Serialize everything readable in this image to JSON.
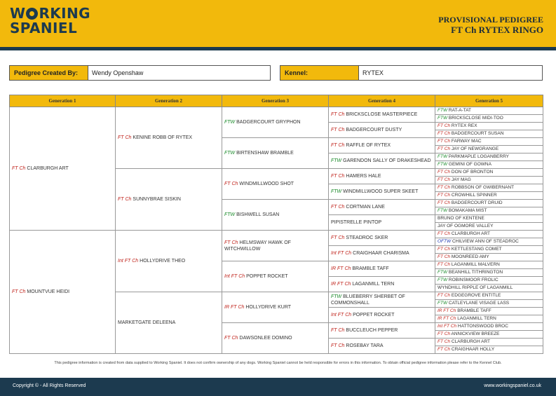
{
  "header": {
    "logo_line1_a": "W",
    "logo_line1_b": "RKING",
    "logo_line2": "SPANIEL",
    "doc_type": "PROVISIONAL PEDIGREE",
    "dog_name": "FT Ch RYTEX RINGO",
    "accent_color": "#f2b90c",
    "brand_color": "#1c3a4f"
  },
  "meta": {
    "created_by_label": "Pedigree Created By:",
    "created_by_value": "Wendy Openshaw",
    "kennel_label": "Kennel:",
    "kennel_value": "RYTEX"
  },
  "columns": [
    "Generation 1",
    "Generation 2",
    "Generation 3",
    "Generation 4",
    "Generation 5"
  ],
  "gen1": [
    {
      "title": "FT Ch",
      "name": "CLARBURGH ART"
    },
    {
      "title": "FT Ch",
      "name": "MOUNTVUE HEIDI"
    }
  ],
  "gen2": [
    {
      "title": "FT Ch",
      "name": "KENINE ROBB OF RYTEX"
    },
    {
      "title": "FT Ch",
      "name": "SUNNYBRAE SISKIN"
    },
    {
      "title": "Int FT Ch",
      "name": "HOLLYDRIVE THEO"
    },
    {
      "title": "",
      "name": "MARKETGATE DELEENA"
    }
  ],
  "gen3": [
    {
      "title": "FTW",
      "name": "BADGERCOURT GRYPHON"
    },
    {
      "title": "FTW",
      "name": "BIRTENSHAW BRAMBLE"
    },
    {
      "title": "FT Ch",
      "name": "WINDMILLWOOD SHOT"
    },
    {
      "title": "FTW",
      "name": "BISHWELL SUSAN"
    },
    {
      "title": "FT Ch",
      "name": "HELMSWAY HAWK OF WITCHWILLOW"
    },
    {
      "title": "Int FT Ch",
      "name": "POPPET ROCKET"
    },
    {
      "title": "IR FT Ch",
      "name": "HOLLYDRIVE KURT"
    },
    {
      "title": "FT Ch",
      "name": "DAWSONLEE DOMINO"
    }
  ],
  "gen4": [
    {
      "title": "FT Ch",
      "name": "BRICKSCLOSE MASTERPIECE"
    },
    {
      "title": "FT Ch",
      "name": "BADGERCOURT DUSTY"
    },
    {
      "title": "FT Ch",
      "name": "RAFFLE OF RYTEX"
    },
    {
      "title": "FTW",
      "name": "GARENDON SALLY OF DRAKESHEAD"
    },
    {
      "title": "FT Ch",
      "name": "HAMERS HALE"
    },
    {
      "title": "FTW",
      "name": "WINDMILLWOOD SUPER SKEET"
    },
    {
      "title": "FT Ch",
      "name": "CORTMAN LANE"
    },
    {
      "title": "",
      "name": "PIPISTRELLE PINTOP"
    },
    {
      "title": "FT Ch",
      "name": "STEADROC SKER"
    },
    {
      "title": "Int FT Ch",
      "name": "CRAIGHAAR CHARISMA"
    },
    {
      "title": "IR FT Ch",
      "name": "BRAMBLE TAFF"
    },
    {
      "title": "IR FT Ch",
      "name": "LAGANMILL TERN"
    },
    {
      "title": "FTW",
      "name": "BLUEBERRY SHERBET OF COMMONSHALL"
    },
    {
      "title": "Int FT Ch",
      "name": "POPPET ROCKET"
    },
    {
      "title": "FT Ch",
      "name": "BUCCLEUCH PEPPER"
    },
    {
      "title": "FT Ch",
      "name": "ROSEBAY TARA"
    }
  ],
  "gen5": [
    {
      "title": "FTW",
      "name": "RAT-A-TAT"
    },
    {
      "title": "FTW",
      "name": "BRICKSCLOSE MIDI-TOO"
    },
    {
      "title": "FT Ch",
      "name": "RYTEX REX"
    },
    {
      "title": "FT Ch",
      "name": "BADGERCOURT SUSAN"
    },
    {
      "title": "FT Ch",
      "name": "FARWAY MAC"
    },
    {
      "title": "FT Ch",
      "name": "JAY OF NEWGRANGE"
    },
    {
      "title": "FTW",
      "name": "PARKMAPLE LOGANBERRY"
    },
    {
      "title": "FTW",
      "name": "GEMINI OF GOWNA"
    },
    {
      "title": "FT Ch",
      "name": "DON OF BRONTON"
    },
    {
      "title": "FT Ch",
      "name": "JAY MAG"
    },
    {
      "title": "FT Ch",
      "name": "ROBBSON OF GWIBERNANT"
    },
    {
      "title": "FT Ch",
      "name": "CROWHILL SPINNER"
    },
    {
      "title": "FT Ch",
      "name": "BADGERCOURT DRUID"
    },
    {
      "title": "FTW",
      "name": "BOMAKAMA MIST"
    },
    {
      "title": "",
      "name": "BRUNO OF KENTENE"
    },
    {
      "title": "",
      "name": "JAY OF OGMORE VALLEY"
    },
    {
      "title": "FT Ch",
      "name": "CLARBURGH ART"
    },
    {
      "title": "OFTW",
      "name": "CHILVIEW ANN OF STEADROC"
    },
    {
      "title": "FT Ch",
      "name": "KETTLESTANG COMET"
    },
    {
      "title": "FT Ch",
      "name": "MOONREED AMY"
    },
    {
      "title": "FT Ch",
      "name": "LAGANMILL MALVERN"
    },
    {
      "title": "FTW",
      "name": "BEANHILL TITHRINGTON"
    },
    {
      "title": "FTW",
      "name": "ROBINSMOOR FROLIC"
    },
    {
      "title": "",
      "name": "WYNDHILL RIPPLE OF LAGANMILL"
    },
    {
      "title": "FT Ch",
      "name": "EDGEGROVE ENTITLE"
    },
    {
      "title": "FTW",
      "name": "CATLEYLANE VISAGE LASS"
    },
    {
      "title": "IR FT Ch",
      "name": "BRAMBLE TAFF"
    },
    {
      "title": "IR FT Ch",
      "name": "LAGANMILL TERN"
    },
    {
      "title": "Int FT Ch",
      "name": "HATTONSWOOD BROC"
    },
    {
      "title": "FT Ch",
      "name": "ANNICKVIEW BREEZE"
    },
    {
      "title": "FT Ch",
      "name": "CLARBURGH ART"
    },
    {
      "title": "FT Ch",
      "name": "CRAIGHAAR HOLLY"
    }
  ],
  "disclaimer": "This pedigree information is created from data supplied to Working Spaniel. It does not confirm ownership of any dogs. Working Spaniel cannot be held responsible for errors in this information. To obtain official pedigree information please refer to the Kennel Club.",
  "footer": {
    "copyright": "Copyright © - All Rights Reserved",
    "website": "www.workingspaniel.co.uk"
  }
}
